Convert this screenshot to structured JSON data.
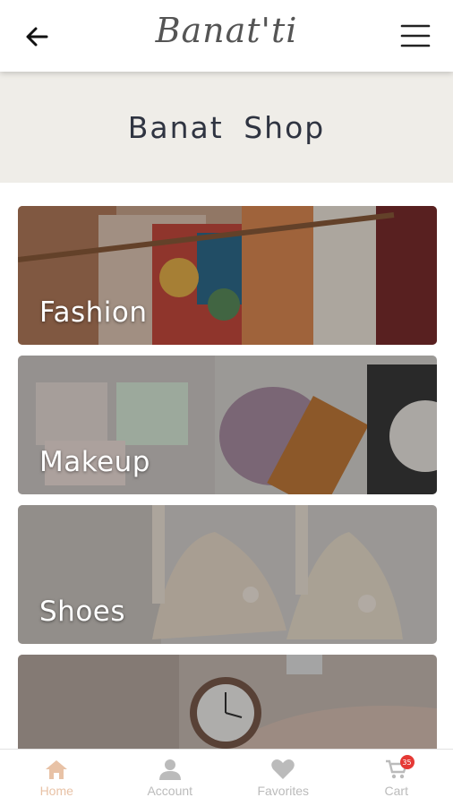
{
  "header": {
    "logo_text": "Banat'ti",
    "back_icon": "arrow-left-icon",
    "menu_icon": "hamburger-menu-icon"
  },
  "hero": {
    "title": "Banat Shop"
  },
  "categories": [
    {
      "label": "Fashion"
    },
    {
      "label": "Makeup"
    },
    {
      "label": "Shoes"
    },
    {
      "label": ""
    }
  ],
  "bottom_nav": {
    "items": [
      {
        "label": "Home",
        "icon": "home-icon",
        "active": true
      },
      {
        "label": "Account",
        "icon": "user-icon",
        "active": false
      },
      {
        "label": "Favorites",
        "icon": "heart-icon",
        "active": false
      },
      {
        "label": "Cart",
        "icon": "cart-icon",
        "active": false,
        "badge": "35"
      }
    ]
  },
  "colors": {
    "active_nav": "#e8c2a6",
    "inactive_nav": "#bbbbbb",
    "hero_bg": "#efede8",
    "badge": "#e53935"
  }
}
